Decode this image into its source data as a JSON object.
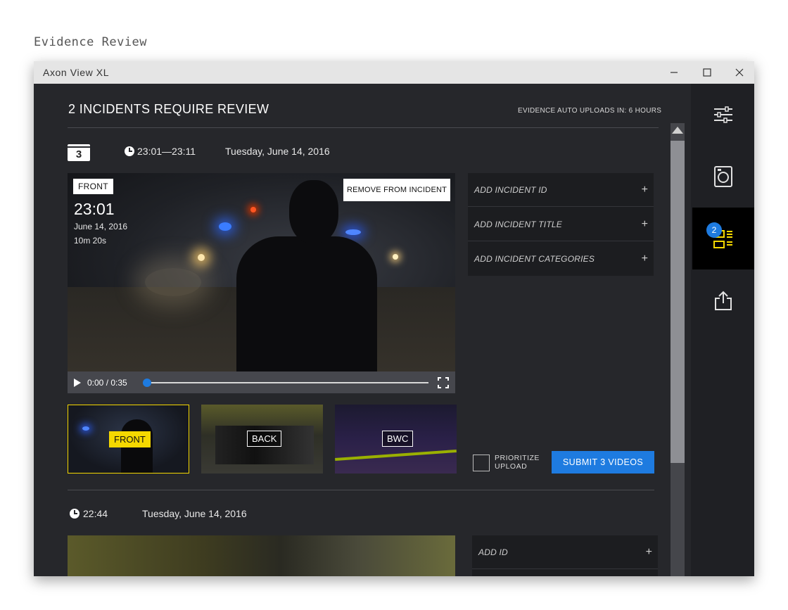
{
  "page": {
    "heading": "Evidence Review"
  },
  "window": {
    "title": "Axon View XL",
    "controls": {
      "minimize": "—",
      "maximize": "☐",
      "close": "✕"
    }
  },
  "header": {
    "title": "2 INCIDENTS REQUIRE REVIEW",
    "auto_upload": "EVIDENCE AUTO UPLOADS IN: 6 HOURS"
  },
  "incident1": {
    "video_count": "3",
    "time_range": "23:01—23:11",
    "date": "Tuesday, June 14, 2016",
    "video": {
      "camera_tag": "FRONT",
      "time": "23:01",
      "date": "June 14, 2016",
      "duration": "10m 20s",
      "remove_label": "REMOVE FROM INCIDENT"
    },
    "player": {
      "time_readout": "0:00 / 0:35",
      "progress": 0
    },
    "thumbnails": [
      {
        "label": "FRONT",
        "selected": true
      },
      {
        "label": "BACK",
        "selected": false
      },
      {
        "label": "BWC",
        "selected": false
      }
    ],
    "fields": [
      {
        "label": "ADD INCIDENT ID",
        "action": "+"
      },
      {
        "label": "ADD INCIDENT  TITLE",
        "action": "+"
      },
      {
        "label": "ADD INCIDENT CATEGORIES",
        "action": "+"
      }
    ],
    "prioritize_label": "PRIORITIZE UPLOAD",
    "submit_label": "SUBMIT 3 VIDEOS"
  },
  "incident2": {
    "time": "22:44",
    "date": "Tuesday, June 14, 2016",
    "fields": [
      {
        "label": "ADD ID",
        "action": "+"
      }
    ]
  },
  "sidebar": {
    "items": [
      {
        "name": "settings",
        "icon": "sliders-icon"
      },
      {
        "name": "camera",
        "icon": "camera-icon"
      },
      {
        "name": "incidents",
        "icon": "incident-list-icon",
        "badge": "2",
        "active": true
      },
      {
        "name": "share",
        "icon": "share-icon"
      }
    ]
  },
  "colors": {
    "accent": "#1e7be0",
    "highlight": "#f5d800",
    "background": "#26272b",
    "sidebar": "#1f2024"
  }
}
